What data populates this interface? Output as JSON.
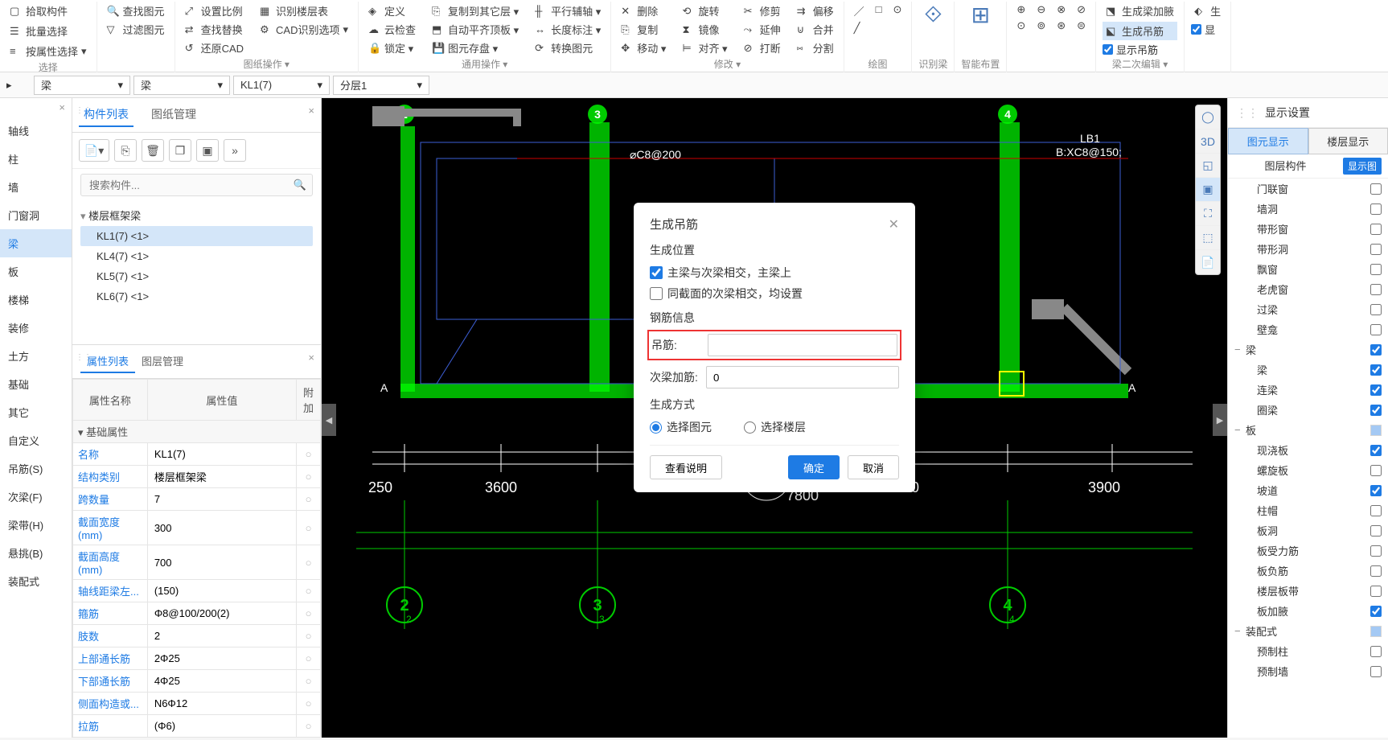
{
  "ribbon": {
    "groups": [
      {
        "label": "选择",
        "items": [
          "拾取构件",
          "批量选择",
          "按属性选择"
        ],
        "items2": [
          "查找图元",
          "过滤图元",
          ""
        ]
      },
      {
        "label": "图纸操作 ▾",
        "items": [
          "设置比例",
          "查找替换",
          "还原CAD"
        ],
        "items2": [
          "识别楼层表",
          "CAD识别选项",
          ""
        ]
      },
      {
        "label": "",
        "items": [
          "定义",
          "云检查",
          "锁定 ▾"
        ],
        "items2": [
          "复制到其它层 ▾",
          "自动平齐顶板 ▾",
          "图元存盘 ▾"
        ]
      },
      {
        "label": "通用操作 ▾",
        "items": [
          "平行辅轴 ▾",
          "长度标注 ▾",
          "转换图元"
        ]
      },
      {
        "label": "",
        "items": [
          "删除",
          "复制",
          "移动 ▾"
        ],
        "items2": [
          "旋转",
          "镜像",
          "对齐 ▾"
        ]
      },
      {
        "label": "修改 ▾",
        "items": [
          "修剪",
          "延伸",
          "打断"
        ],
        "items2": [
          "偏移",
          "合并",
          "分割"
        ]
      },
      {
        "label": "绘图",
        "items": [
          "/",
          "□",
          "⊙"
        ],
        "items2": [
          "╱",
          "",
          ""
        ]
      },
      {
        "label": "识别梁",
        "items": [
          "识别梁",
          ""
        ]
      },
      {
        "label": "智能布置",
        "items": [
          "智能布置",
          ""
        ]
      },
      {
        "label": "",
        "items": [
          "",
          "",
          "",
          ""
        ]
      },
      {
        "label": "梁二次编辑 ▾",
        "items": [
          "生成梁加腋",
          "生成吊筋",
          "显示吊筋"
        ],
        "checks": [
          false,
          true,
          true
        ]
      }
    ]
  },
  "selectors": {
    "a": "梁",
    "b": "梁",
    "c": "KL1(7)",
    "d": "分层1"
  },
  "left_nav": [
    "轴线",
    "柱",
    "墙",
    "门窗洞",
    "梁",
    "板",
    "楼梯",
    "装修",
    "土方",
    "基础",
    "其它",
    "自定义",
    "吊筋(S)",
    "次梁(F)",
    "梁带(H)",
    "悬挑(B)",
    "装配式"
  ],
  "left_active_idx": 4,
  "component_panel": {
    "tabs": [
      "构件列表",
      "图纸管理"
    ],
    "search_placeholder": "搜索构件...",
    "group": "楼层框架梁",
    "items": [
      "KL1(7) <1>",
      "KL4(7) <1>",
      "KL5(7) <1>",
      "KL6(7) <1>"
    ],
    "selected_idx": 0
  },
  "property_panel": {
    "tabs": [
      "属性列表",
      "图层管理"
    ],
    "headers": [
      "属性名称",
      "属性值",
      "附加"
    ],
    "group": "基础属性",
    "rows": [
      {
        "name": "名称",
        "value": "KL1(7)"
      },
      {
        "name": "结构类别",
        "value": "楼层框架梁"
      },
      {
        "name": "跨数量",
        "value": "7"
      },
      {
        "name": "截面宽度(mm)",
        "value": "300"
      },
      {
        "name": "截面高度(mm)",
        "value": "700"
      },
      {
        "name": "轴线距梁左...",
        "value": "(150)"
      },
      {
        "name": "箍筋",
        "value": "Φ8@100/200(2)"
      },
      {
        "name": "肢数",
        "value": "2"
      },
      {
        "name": "上部通长筋",
        "value": "2Φ25"
      },
      {
        "name": "下部通长筋",
        "value": "4Φ25"
      },
      {
        "name": "侧面构造或...",
        "value": "N6Φ12"
      },
      {
        "name": "拉筋",
        "value": "(Φ6)"
      }
    ]
  },
  "dialog": {
    "title": "生成吊筋",
    "section1": "生成位置",
    "check1": "主梁与次梁相交，主梁上",
    "check2": "同截面的次梁相交，均设置",
    "section2": "钢筋信息",
    "field1_label": "吊筋:",
    "field1_value": "",
    "field2_label": "次梁加筋:",
    "field2_value": "0",
    "section3": "生成方式",
    "radio1": "选择图元",
    "radio2": "选择楼层",
    "btn_help": "查看说明",
    "btn_ok": "确定",
    "btn_cancel": "取消"
  },
  "right_panel": {
    "title": "显示设置",
    "tabs": [
      "图元显示",
      "楼层显示"
    ],
    "sub_l": "图层构件",
    "sub_r": "显示图",
    "items": [
      {
        "label": "门联窗",
        "checked": false,
        "indent": 2
      },
      {
        "label": "墙洞",
        "checked": false,
        "indent": 2
      },
      {
        "label": "带形窗",
        "checked": false,
        "indent": 2
      },
      {
        "label": "带形洞",
        "checked": false,
        "indent": 2
      },
      {
        "label": "飘窗",
        "checked": false,
        "indent": 2
      },
      {
        "label": "老虎窗",
        "checked": false,
        "indent": 2
      },
      {
        "label": "过梁",
        "checked": false,
        "indent": 2
      },
      {
        "label": "壁龛",
        "checked": false,
        "indent": 2
      },
      {
        "label": "梁",
        "checked": true,
        "indent": 1,
        "expand": "−"
      },
      {
        "label": "梁",
        "checked": true,
        "indent": 2
      },
      {
        "label": "连梁",
        "checked": true,
        "indent": 2
      },
      {
        "label": "圈梁",
        "checked": true,
        "indent": 2
      },
      {
        "label": "板",
        "checked": false,
        "indent": 1,
        "expand": "−",
        "half": true
      },
      {
        "label": "现浇板",
        "checked": true,
        "indent": 2
      },
      {
        "label": "螺旋板",
        "checked": false,
        "indent": 2
      },
      {
        "label": "坡道",
        "checked": true,
        "indent": 2
      },
      {
        "label": "柱帽",
        "checked": false,
        "indent": 2
      },
      {
        "label": "板洞",
        "checked": false,
        "indent": 2
      },
      {
        "label": "板受力筋",
        "checked": false,
        "indent": 2
      },
      {
        "label": "板负筋",
        "checked": false,
        "indent": 2
      },
      {
        "label": "楼层板带",
        "checked": false,
        "indent": 2
      },
      {
        "label": "板加腋",
        "checked": true,
        "indent": 2
      },
      {
        "label": "装配式",
        "checked": false,
        "indent": 1,
        "expand": "−",
        "half": true
      },
      {
        "label": "预制柱",
        "checked": false,
        "indent": 2
      },
      {
        "label": "预制墙",
        "checked": false,
        "indent": 2
      }
    ]
  },
  "canvas": {
    "top_markers": [
      "2",
      "3",
      "4"
    ],
    "bottom_markers": [
      "2",
      "3",
      "4"
    ],
    "dims": [
      "250",
      "3600",
      "3900",
      "7800",
      "3900",
      "3900"
    ],
    "label1": "⌀C8@200",
    "label2": "LB1",
    "label3": "B:XC8@150;"
  }
}
